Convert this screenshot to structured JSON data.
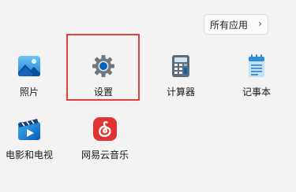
{
  "header": {
    "all_apps_label": "所有应用",
    "all_apps_chevron": "›"
  },
  "pinned_apps": [
    {
      "label": "照片",
      "icon": "photos-icon"
    },
    {
      "label": "设置",
      "icon": "settings-gear-icon",
      "highlighted": true
    },
    {
      "label": "计算器",
      "icon": "calculator-icon"
    },
    {
      "label": "记事本",
      "icon": "notepad-icon"
    },
    {
      "label": "电影和电视",
      "icon": "movies-tv-icon"
    },
    {
      "label": "网易云音乐",
      "icon": "netease-music-icon"
    }
  ],
  "colors": {
    "background": "#f3f3f3",
    "highlight_border": "#e0413c",
    "accent_blue": "#0067c0",
    "netease_red": "#e03434"
  }
}
